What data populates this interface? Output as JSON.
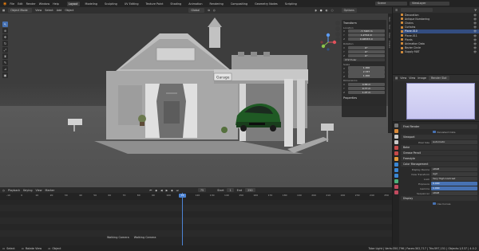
{
  "menu": [
    "File",
    "Edit",
    "Render",
    "Window",
    "Help"
  ],
  "workspaces": [
    "Layout",
    "Modeling",
    "Sculpting",
    "UV Editing",
    "Texture Paint",
    "Shading",
    "Animation",
    "Rendering",
    "Compositing",
    "Geometry Nodes",
    "Scripting"
  ],
  "active_workspace": "Layout",
  "scene_name": "Scene",
  "view_layer": "ViewLayer",
  "viewport_header": {
    "mode": "Object Mode",
    "menus": [
      "View",
      "Select",
      "Add",
      "Object"
    ],
    "orientation": "Global",
    "options": "Options"
  },
  "npanel": {
    "transform_title": "Transform",
    "location_label": "Location",
    "location": [
      "-7.7403 m",
      "1.2714 m",
      "0.94533 m"
    ],
    "rotation_label": "Rotation",
    "rotation": [
      "0°",
      "0°",
      "0°"
    ],
    "rotation_mode": "XYZ Euler",
    "scale_label": "Scale",
    "scale": [
      "1.000",
      "2.337",
      "1.000"
    ],
    "dimensions_label": "Dimensions",
    "dimensions": [
      "4.58 m",
      "0.77 m",
      "1.07 m"
    ],
    "properties_title": "Properties",
    "axes": [
      "X",
      "Y",
      "Z"
    ],
    "tabs": [
      "Item",
      "Tool",
      "View",
      "Create"
    ]
  },
  "sign_text": "Garage",
  "outliner": {
    "items": [
      {
        "label": "Decoration",
        "sel": false
      },
      {
        "label": "Antique Numbering",
        "sel": false
      },
      {
        "label": "Chains",
        "sel": false
      },
      {
        "label": "Curtains",
        "sel": false
      },
      {
        "label": "Plane.010",
        "sel": true
      },
      {
        "label": "Plane.011",
        "sel": false
      },
      {
        "label": "Plants",
        "sel": false
      },
      {
        "label": "Animation Data",
        "sel": false
      },
      {
        "label": "Bezier Circle",
        "sel": false
      },
      {
        "label": "Supply MAT",
        "sel": false
      }
    ]
  },
  "uv_header": {
    "items": [
      "View",
      "View",
      "Image",
      "Render Slot"
    ]
  },
  "properties": {
    "final_render": "Final Render",
    "persistent_data": "Persistent Data",
    "viewport": "Viewport",
    "pixel_size_label": "Pixel Size",
    "pixel_size_value": "Automatic",
    "bake": "Bake",
    "grease_pencil": "Grease Pencil",
    "freestyle": "Freestyle",
    "color_management": "Color Management",
    "display_device_label": "Display Device",
    "display_device": "sRGB",
    "view_transform_label": "View Transform",
    "view_transform": "AgX",
    "look_label": "Look",
    "look": "Very High Contrast",
    "exposure_label": "Exposure",
    "exposure": "0.000",
    "gamma_label": "Gamma",
    "gamma": "1.000",
    "sequencer_label": "Sequencer",
    "sequencer": "sRGB",
    "display": "Display",
    "use_curves": "Use Curves"
  },
  "timeline": {
    "menus": [
      "Playback",
      "Keying",
      "View",
      "Marker"
    ],
    "current_frame": "75",
    "frames": [
      "-10",
      "0",
      "10",
      "20",
      "30",
      "40",
      "50",
      "60",
      "70",
      "80",
      "90",
      "100",
      "110",
      "120",
      "130",
      "140",
      "150",
      "160",
      "170",
      "180",
      "190",
      "200",
      "210",
      "220",
      "230",
      "240",
      "250"
    ],
    "markers": [
      "Walking Camera",
      "Walking Camera"
    ],
    "start_label": "Start",
    "start": "1",
    "end_label": "End",
    "end": "250"
  },
  "statusbar": {
    "left": [
      "Select",
      "Rotate View",
      "Object"
    ],
    "right": "Tube Light | Verts:350,796 | Faces:302,717 | Tris:597,151 | Objects:1/137 | 4.0.2"
  }
}
